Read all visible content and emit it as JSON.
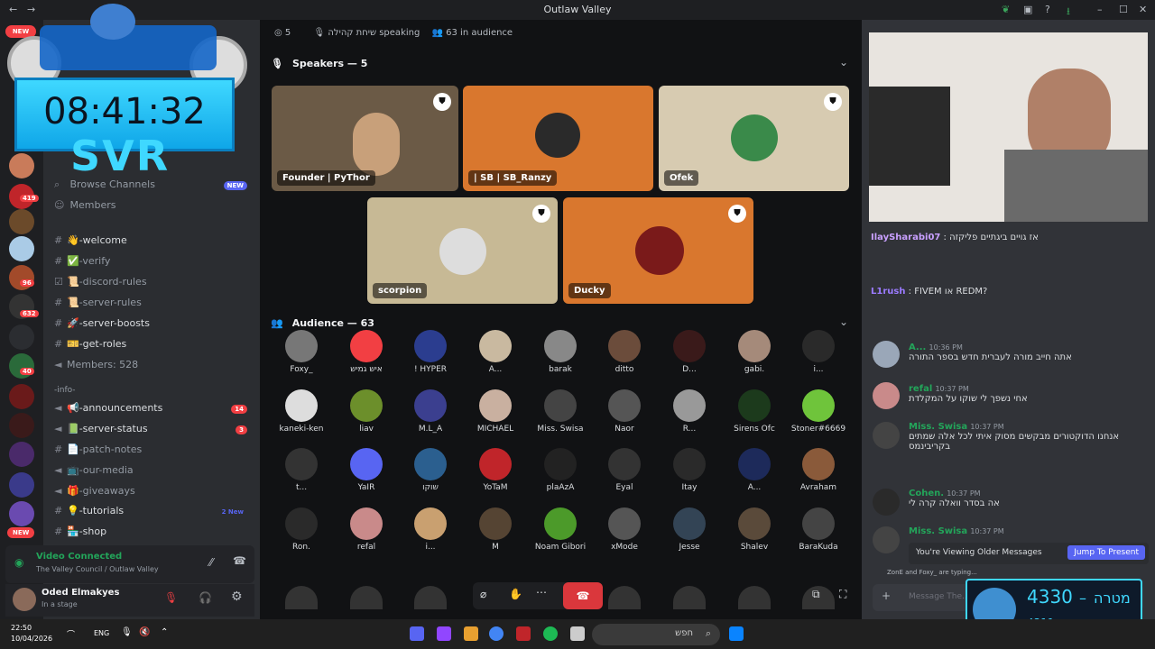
{
  "window": {
    "title": "Outlaw Valley"
  },
  "overlay": {
    "clock": "08:41:32",
    "tag": "SVR",
    "new_badge": "NEW"
  },
  "sidebar": {
    "browse": "Browse Channels",
    "browse_badge": "NEW",
    "members": "Members",
    "channels": [
      {
        "name": "-welcome",
        "emoji": "👋"
      },
      {
        "name": "-verify",
        "emoji": "✅"
      },
      {
        "name": "-discord-rules",
        "emoji": "📜"
      },
      {
        "name": "-server-rules",
        "emoji": "📜"
      },
      {
        "name": "-server-boosts",
        "emoji": "🚀"
      },
      {
        "name": "-get-roles",
        "emoji": "🎫"
      },
      {
        "name": "Members: 528",
        "emoji": ""
      }
    ],
    "category": "-info-",
    "channels2": [
      {
        "name": "-announcements",
        "emoji": "📢",
        "badge": "14"
      },
      {
        "name": "-server-status",
        "emoji": "📗",
        "badge": "3"
      },
      {
        "name": "-patch-notes",
        "emoji": "📄",
        "badge": ""
      },
      {
        "name": "-our-media",
        "emoji": "📺",
        "badge": ""
      },
      {
        "name": "-giveaways",
        "emoji": "🎁",
        "badge": ""
      },
      {
        "name": "-tutorials",
        "emoji": "💡",
        "badge": "2 New"
      },
      {
        "name": "-shop",
        "emoji": "🏪",
        "badge": ""
      }
    ],
    "voice": {
      "status": "Video Connected",
      "server": "The Valley Council / Outlaw Valley"
    },
    "user": {
      "name": "Oded Elmakyes",
      "status": "In a stage"
    }
  },
  "stage": {
    "header": {
      "channel": "שיחת קהילה",
      "speaking": "5 speaking",
      "audience": "63 in audience"
    },
    "speakers_label": "Speakers — 5",
    "speakers": [
      {
        "name": "Founder | PyThor",
        "color": "#6b5a46"
      },
      {
        "name": "| SB | SB_Ranzy",
        "color": "#d9772e"
      },
      {
        "name": "Ofek",
        "color": "#d7cbb1"
      },
      {
        "name": "scorpion",
        "color": "#c7b995"
      },
      {
        "name": "Ducky",
        "color": "#d9772e"
      }
    ],
    "audience_label": "Audience — 63",
    "audience": [
      {
        "name": "Foxy_",
        "c": "#777"
      },
      {
        "name": "איש גמיש",
        "c": "#f23f43"
      },
      {
        "name": "! HYPER",
        "c": "#2b3d8f"
      },
      {
        "name": "A...",
        "c": "#c9b9a0"
      },
      {
        "name": "barak",
        "c": "#888"
      },
      {
        "name": "ditto",
        "c": "#6b4c3b"
      },
      {
        "name": "D...",
        "c": "#3a1a1a"
      },
      {
        "name": "gabi.",
        "c": "#a58a7a"
      },
      {
        "name": "i...",
        "c": "#2a2a2a"
      },
      {
        "name": "kaneki-ken",
        "c": "#ddd"
      },
      {
        "name": "liav",
        "c": "#6c8f2b"
      },
      {
        "name": "M.L_A",
        "c": "#3b3f8f"
      },
      {
        "name": "MICHAEL",
        "c": "#c9b0a0"
      },
      {
        "name": "Miss. Swisa",
        "c": "#444"
      },
      {
        "name": "Naor",
        "c": "#555"
      },
      {
        "name": "R...",
        "c": "#999"
      },
      {
        "name": "Sirens Ofc",
        "c": "#1c3a1c"
      },
      {
        "name": "Stoner#6669",
        "c": "#6fc43b"
      },
      {
        "name": "t...",
        "c": "#333"
      },
      {
        "name": "YaIR",
        "c": "#5865f2"
      },
      {
        "name": "שוקו",
        "c": "#2b5f8f"
      },
      {
        "name": "YoTaM",
        "c": "#c0252a"
      },
      {
        "name": "plaAzA",
        "c": "#222"
      },
      {
        "name": "Eyal",
        "c": "#333"
      },
      {
        "name": "Itay",
        "c": "#2a2a2a"
      },
      {
        "name": "A...",
        "c": "#1d2a5a"
      },
      {
        "name": "Avraham",
        "c": "#8a5a3a"
      },
      {
        "name": "Ron.",
        "c": "#2a2a2a"
      },
      {
        "name": "refal",
        "c": "#c98a8a"
      },
      {
        "name": "i...",
        "c": "#c9a070"
      },
      {
        "name": "M",
        "c": "#554433"
      },
      {
        "name": "Noam Gibori",
        "c": "#4c9a2a"
      },
      {
        "name": "xMode",
        "c": "#555"
      },
      {
        "name": "Jesse",
        "c": "#334455"
      },
      {
        "name": "Shalev",
        "c": "#5a4a3a"
      },
      {
        "name": "BaraKuda",
        "c": "#444"
      }
    ]
  },
  "chat": {
    "messages": [
      {
        "name": "IlaySharabi07",
        "text": ": אז גויים ביגתיים פליקזה",
        "time": ""
      },
      {
        "name": "L1rush",
        "text": ": FIVEM או REDM?",
        "time": ""
      },
      {
        "name": "A...",
        "text": "אתה חייב מורה לעברית חדש בספר התורה",
        "time": "10:36 PM"
      },
      {
        "name": "refal",
        "text": "אחי נשפך לי שוקו על המקלדת",
        "time": "10:37 PM"
      },
      {
        "name": "Miss. Swisa",
        "text": "אנחנו הדוקטורים מבקשים מסוק איתי לכל אלה שמתים בקריבינמס",
        "time": "10:37 PM"
      },
      {
        "name": "Cohen.",
        "text": "אה בסדר וואלה קרה לי",
        "time": "10:37 PM"
      },
      {
        "name": "Miss. Swisa",
        "text": "",
        "time": "10:37 PM"
      }
    ],
    "older_notice": "You're Viewing Older Messages",
    "jump": "Jump To Present",
    "typing": "ZonE and Foxy_ are typing...",
    "input_placeholder": "Message The..."
  },
  "score": {
    "value": "4330",
    "target": "מטרה",
    "sub": "4311"
  },
  "taskbar": {
    "time": "22:50",
    "date": "10/04/2026",
    "lang": "ENG",
    "search": "חפש"
  }
}
